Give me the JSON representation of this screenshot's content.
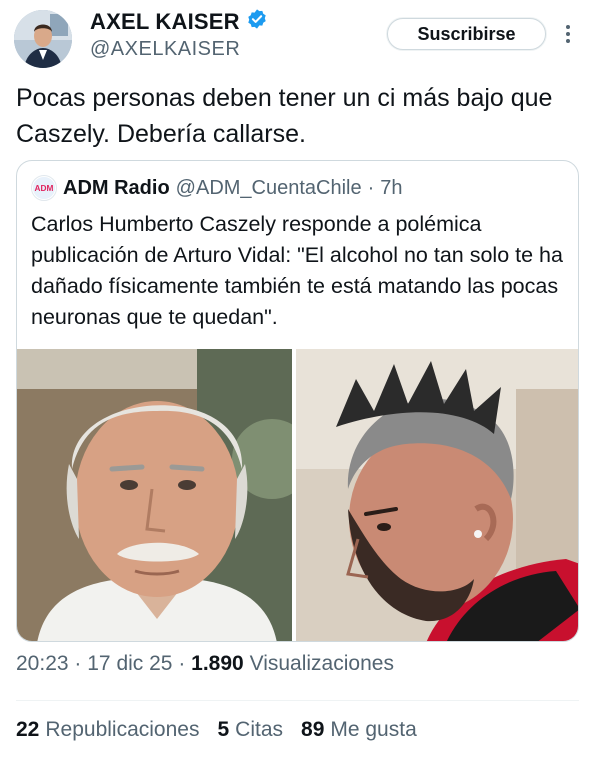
{
  "author": {
    "display_name": "AXEL KAISER",
    "handle": "@AXELKAISER",
    "verified_color": "#1d9bf0"
  },
  "actions": {
    "subscribe_label": "Suscribirse",
    "more_icon": "more-vertical-icon"
  },
  "tweet": {
    "text": "Pocas personas deben tener un ci más bajo que Caszely. Debería callarse."
  },
  "quote": {
    "logo_text": "ADM",
    "display_name": "ADM Radio",
    "handle": "@ADM_CuentaChile",
    "separator": "·",
    "time": "7h",
    "text": "Carlos Humberto Caszely responde a polémica publicación de Arturo Vidal: \"El alcohol no tan solo te ha dañado físicamente también te está matando las pocas neuronas que te quedan\".",
    "photos": [
      {
        "subject": "older man with white hair and mustache"
      },
      {
        "subject": "athlete with mohawk hairstyle and beard"
      }
    ]
  },
  "meta": {
    "time": "20:23",
    "sep1": "·",
    "date": "17 dic 25",
    "sep2": "·",
    "views_count": "1.890",
    "views_label": "Visualizaciones"
  },
  "stats": {
    "reposts_count": "22",
    "reposts_label": "Republicaciones",
    "quotes_count": "5",
    "quotes_label": "Citas",
    "likes_count": "89",
    "likes_label": "Me gusta"
  }
}
